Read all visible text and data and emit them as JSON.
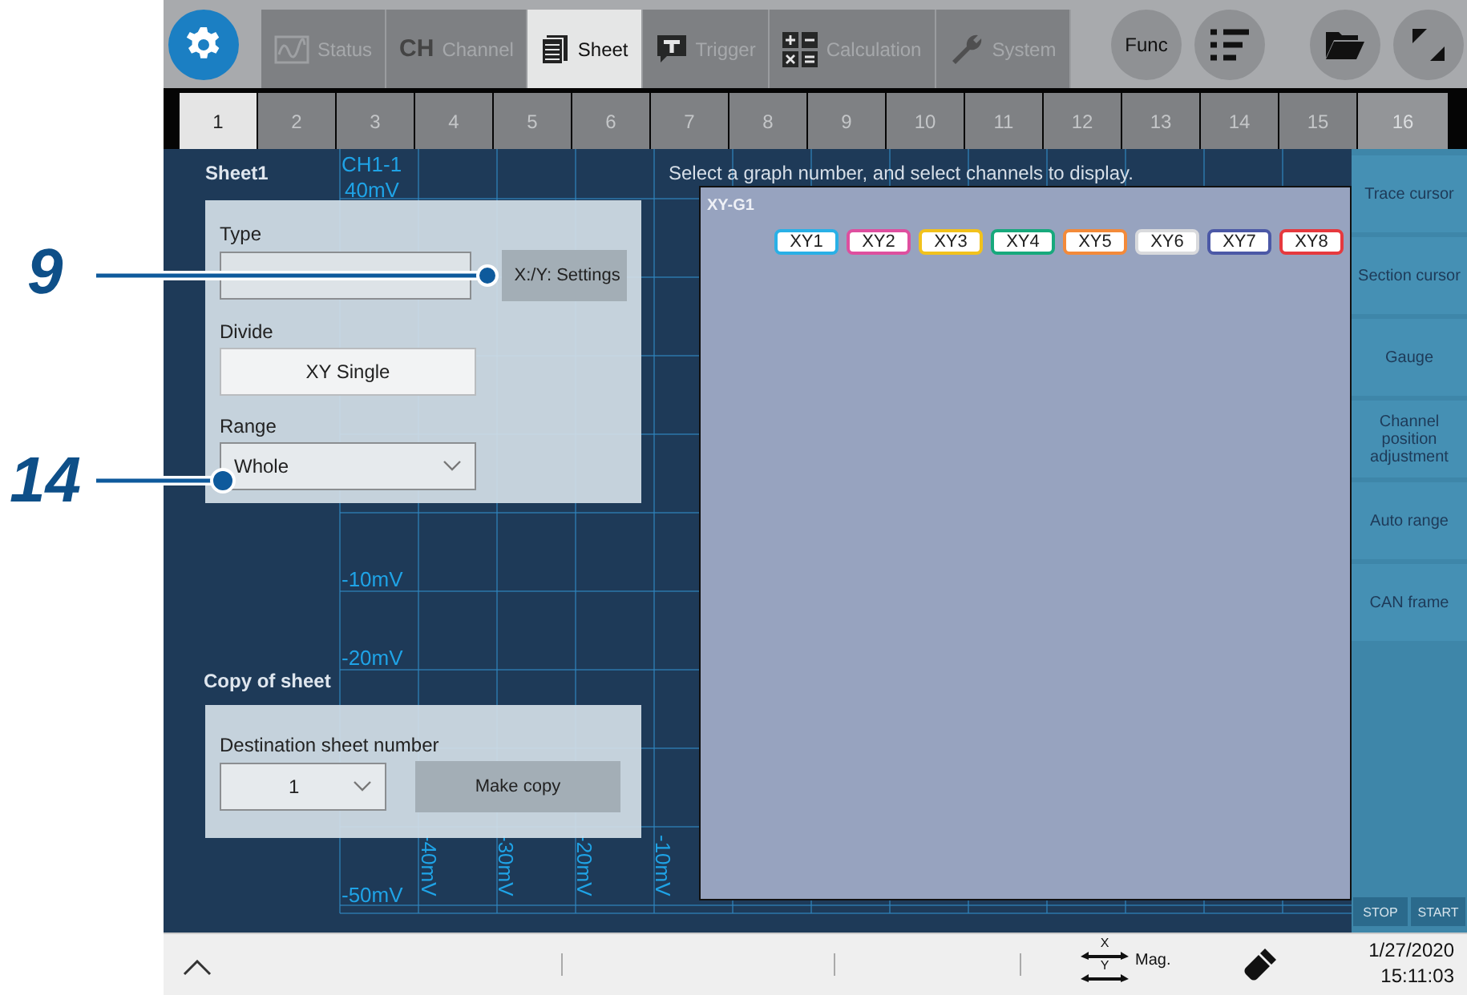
{
  "callouts": [
    {
      "label": "9"
    },
    {
      "label": "14"
    }
  ],
  "toolbar": {
    "tabs": [
      {
        "label": "Status",
        "kind": "status",
        "selected": false
      },
      {
        "label": "Channel",
        "kind": "channel",
        "icon_text": "CH",
        "selected": false
      },
      {
        "label": "Sheet",
        "kind": "sheet",
        "selected": true
      },
      {
        "label": "Trigger",
        "kind": "trigger",
        "selected": false
      },
      {
        "label": "Calculation",
        "kind": "calculation",
        "selected": false
      },
      {
        "label": "System",
        "kind": "system",
        "selected": false
      }
    ],
    "buttons": [
      {
        "kind": "func",
        "label": "Func"
      },
      {
        "kind": "list"
      },
      {
        "kind": "folder"
      },
      {
        "kind": "expand"
      }
    ]
  },
  "sheet_tabs": [
    {
      "label": "1",
      "selected": true
    },
    {
      "label": "2",
      "selected": false
    },
    {
      "label": "3",
      "selected": false
    },
    {
      "label": "4",
      "selected": false
    },
    {
      "label": "5",
      "selected": false
    },
    {
      "label": "6",
      "selected": false
    },
    {
      "label": "7",
      "selected": false
    },
    {
      "label": "8",
      "selected": false
    },
    {
      "label": "9",
      "selected": false
    },
    {
      "label": "10",
      "selected": false
    },
    {
      "label": "11",
      "selected": false
    },
    {
      "label": "12",
      "selected": false
    },
    {
      "label": "13",
      "selected": false
    },
    {
      "label": "14",
      "selected": false
    },
    {
      "label": "15",
      "selected": false
    },
    {
      "label": "16",
      "selected": false
    }
  ],
  "graph": {
    "channel": "CH1-1",
    "scale": "40mV",
    "y_labels": [
      "-10mV",
      "-20mV",
      "-50mV"
    ],
    "x_labels": [
      "-40mV",
      "-30mV",
      "-20mV",
      "-10mV"
    ]
  },
  "settings": {
    "title": "Sheet1",
    "type_label": "Type",
    "settings_button": "X:/Y: Settings",
    "divide_label": "Divide",
    "divide_value": "XY Single",
    "range_label": "Range",
    "range_value": "Whole"
  },
  "copy": {
    "title": "Copy of sheet",
    "destination_label": "Destination sheet number",
    "destination_value": "1",
    "button": "Make copy"
  },
  "hint": "Select a graph number, and select channels to display.",
  "xy_dialog": {
    "title": "XY-G1",
    "channels": [
      {
        "label": "XY1",
        "color": "#29b0e6"
      },
      {
        "label": "XY2",
        "color": "#de4f9f"
      },
      {
        "label": "XY3",
        "color": "#f2c21c"
      },
      {
        "label": "XY4",
        "color": "#17a97c"
      },
      {
        "label": "XY5",
        "color": "#f38a3a"
      },
      {
        "label": "XY6",
        "color": "#d9dadd"
      },
      {
        "label": "XY7",
        "color": "#4b58a6"
      },
      {
        "label": "XY8",
        "color": "#e6393e"
      }
    ]
  },
  "side_panel": {
    "items": [
      "Trace cursor",
      "Section cursor",
      "Gauge",
      "Channel position adjustment",
      "Auto range",
      "CAN frame"
    ],
    "stop": "STOP",
    "start": "START"
  },
  "status_bar": {
    "axis_x": "X",
    "axis_y": "Y",
    "mag_label": "Mag.",
    "date": "1/27/2020",
    "time": "15:11:03"
  }
}
